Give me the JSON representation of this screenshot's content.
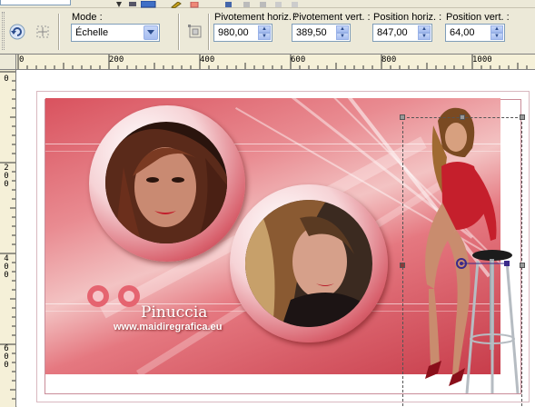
{
  "options_bar": {
    "mode": {
      "label": "Mode :",
      "value": "Échelle"
    },
    "pivot_h": {
      "label": "Pivotement horiz. :",
      "value": "980,00"
    },
    "pivot_v": {
      "label": "Pivotement vert. :",
      "value": "389,50"
    },
    "pos_h": {
      "label": "Position horiz. :",
      "value": "847,00"
    },
    "pos_v": {
      "label": "Position vert. :",
      "value": "64,00"
    }
  },
  "ruler": {
    "h_labels": [
      "0",
      "200",
      "400",
      "600",
      "800",
      "1000"
    ],
    "v_labels": [
      {
        "chars": [
          "0"
        ]
      },
      {
        "chars": [
          "2",
          "0",
          "0"
        ]
      },
      {
        "chars": [
          "4",
          "0",
          "0"
        ]
      },
      {
        "chars": [
          "6",
          "0",
          "0"
        ]
      }
    ]
  },
  "canvas": {
    "signature": "Pinuccia",
    "website": "www.maidiregrafica.eu"
  },
  "colors": {
    "poster_red": "#d9525e",
    "ring_dark": "#9e1f2e",
    "accent_blue": "#2c4d8e"
  },
  "icons": [
    "undo-arrow-icon",
    "selection-icon",
    "transform-icon",
    "dropdown-arrow-icon",
    "spinner-arrows-icon"
  ]
}
